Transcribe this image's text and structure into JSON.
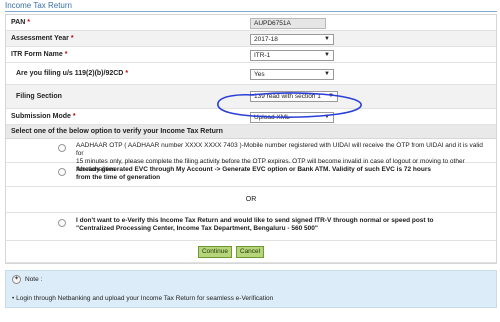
{
  "page": {
    "title": "Income Tax Return"
  },
  "fields": {
    "pan": {
      "label": "PAN",
      "required_mark": "*",
      "value": "AUPD6751A"
    },
    "assessment_year": {
      "label": "Assessment Year",
      "required_mark": "*",
      "value": "2017-18"
    },
    "itr_form_name": {
      "label": "ITR Form Name",
      "required_mark": "*",
      "value": "ITR-1"
    },
    "filing_119": {
      "label": "Are you filing u/s 119(2)(b)/92CD",
      "required_mark": "*",
      "value": "Yes"
    },
    "filing_section": {
      "label": "Filing Section",
      "value": "139 read with section 1"
    },
    "submission_mode": {
      "label": "Submission Mode",
      "required_mark": "*",
      "value": "Upload XML"
    }
  },
  "verify": {
    "heading": "Select one of the below option to verify your Income Tax Return",
    "option_aadhaar_line1": "AADHAAR OTP ( AADHAAR number XXXX XXXX 7403 )-Mobile number registered with UIDAI will receive the OTP from UIDAI and it is valid for",
    "option_aadhaar_line2": "15 minutes only, please complete the filing activity before the OTP expires. OTP will become invalid in case of logout or moving to other functionalities",
    "option_evc_line1": "Already generated EVC through My Account -> Generate EVC option or Bank ATM. Validity of such EVC is 72 hours",
    "option_evc_line2": "from the time of generation",
    "or_text": "OR",
    "option_itrv_line1": "I don't want to e-Verify this Income Tax Return and would like to send signed ITR-V through normal or speed post to",
    "option_itrv_line2": "\"Centralized Processing Center, Income Tax Department, Bengaluru - 560 500\""
  },
  "buttons": {
    "continue": "Continue",
    "cancel": "Cancel"
  },
  "note": {
    "title": "Note :",
    "icon": "bulb-icon",
    "items": [
      "Login through Netbanking and upload your Income Tax Return for seamless e-Verification"
    ]
  },
  "colors": {
    "title": "#3a6fa8",
    "required": "#d00000",
    "button": "#b6d47a",
    "note_bg": "#dcecf8",
    "pen_annotation": "#2b3fd6"
  },
  "icons": {
    "dropdown": "chevron-down-icon",
    "radio": "radio-icon",
    "bullet": "bullet-icon"
  }
}
